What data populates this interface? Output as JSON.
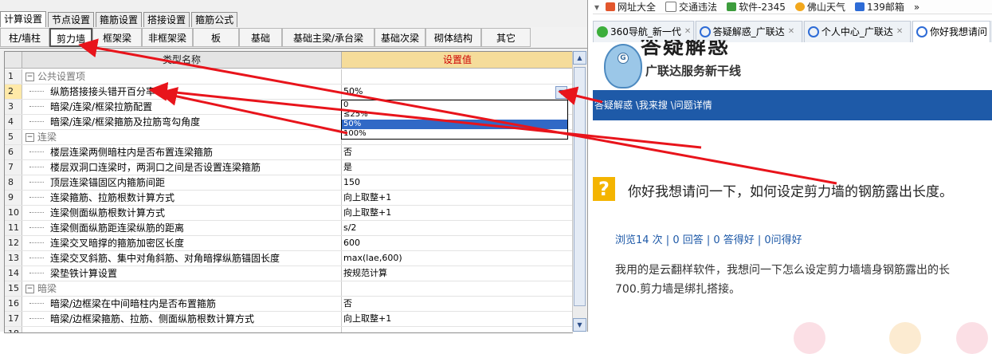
{
  "left": {
    "main_tabs": [
      "计算设置",
      "节点设置",
      "箍筋设置",
      "搭接设置",
      "箍筋公式"
    ],
    "sub_tabs": [
      "柱/墙柱",
      "剪力墙",
      "框架梁",
      "非框架梁",
      "板",
      "基础",
      "基础主梁/承台梁",
      "基础次梁",
      "砌体结构",
      "其它"
    ],
    "header": {
      "name": "类型名称",
      "value": "设置值"
    },
    "rows": [
      {
        "num": "1",
        "name": "公共设置项",
        "value": "",
        "group": true
      },
      {
        "num": "2",
        "name": "纵筋搭接接头错开百分率",
        "value": "50%",
        "group": false
      },
      {
        "num": "3",
        "name": "暗梁/连梁/框梁拉筋配置",
        "value": "",
        "group": false
      },
      {
        "num": "4",
        "name": "暗梁/连梁/框梁箍筋及拉筋弯勾角度",
        "value": "",
        "group": false
      },
      {
        "num": "5",
        "name": "连梁",
        "value": "",
        "group": true
      },
      {
        "num": "6",
        "name": "楼层连梁两侧暗柱内是否布置连梁箍筋",
        "value": "否",
        "group": false
      },
      {
        "num": "7",
        "name": "楼层双洞口连梁时，两洞口之间是否设置连梁箍筋",
        "value": "是",
        "group": false
      },
      {
        "num": "8",
        "name": "顶层连梁锚固区内箍筋间距",
        "value": "150",
        "group": false
      },
      {
        "num": "9",
        "name": "连梁箍筋、拉筋根数计算方式",
        "value": "向上取整+1",
        "group": false
      },
      {
        "num": "10",
        "name": "连梁侧面纵筋根数计算方式",
        "value": "向上取整+1",
        "group": false
      },
      {
        "num": "11",
        "name": "连梁侧面纵筋距连梁纵筋的距离",
        "value": "s/2",
        "group": false
      },
      {
        "num": "12",
        "name": "连梁交叉暗撑的箍筋加密区长度",
        "value": "600",
        "group": false
      },
      {
        "num": "13",
        "name": "连梁交叉斜筋、集中对角斜筋、对角暗撑纵筋锚固长度",
        "value": "max(lae,600)",
        "group": false
      },
      {
        "num": "14",
        "name": "梁垫铁计算设置",
        "value": "按规范计算",
        "group": false
      },
      {
        "num": "15",
        "name": "暗梁",
        "value": "",
        "group": true
      },
      {
        "num": "16",
        "name": "暗梁/边框梁在中间暗柱内是否布置箍筋",
        "value": "否",
        "group": false
      },
      {
        "num": "17",
        "name": "暗梁/边框梁箍筋、拉筋、侧面纵筋根数计算方式",
        "value": "向上取整+1",
        "group": false
      },
      {
        "num": "18",
        "name": "",
        "value": "",
        "group": false
      }
    ],
    "dropdown_options": [
      "0",
      "≤25%",
      "50%",
      "100%"
    ],
    "dropdown_selected": "50%"
  },
  "right": {
    "bookmarks": [
      "网址大全",
      "交通违法",
      "软件-2345",
      "佛山天气",
      "139邮箱",
      "»"
    ],
    "tabs": [
      "360导航_新一代",
      "答疑解惑_广联达",
      "个人中心_广联达",
      "你好我想请问"
    ],
    "brand_title": "答疑解惑",
    "brand_subtitle": "广联达服务新干线",
    "breadcrumb": "答疑解惑 \\我来搜 \\问题详情",
    "question_icon": "?",
    "question_title": "你好我想请问一下，如何设定剪力墙的钢筋露出长度。",
    "stats": "浏览14 次 | 0 回答 | 0 答得好 | 0问得好",
    "body_line1": "我用的是云翻样软件，我想问一下怎么设定剪力墙墙身钢筋露出的长",
    "body_line2": "700.剪力墙是绑扎搭接。"
  },
  "colors": {
    "arrow": "#e8141b",
    "highlight": "#3169c6",
    "header_value_bg": "#f5dc9a",
    "nav_blue": "#1e5aa8"
  }
}
